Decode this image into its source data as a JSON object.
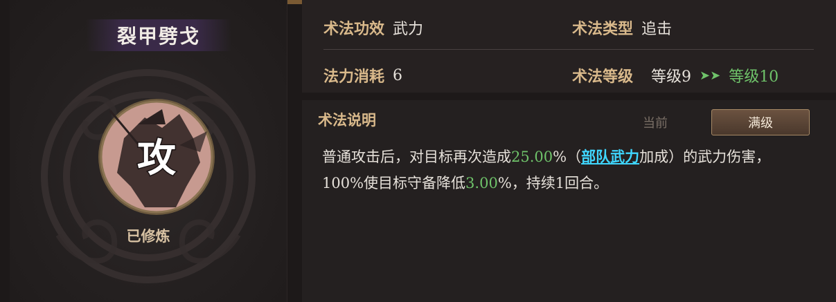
{
  "skill": {
    "name": "裂甲劈戈",
    "badge_char": "攻",
    "status": "已修炼"
  },
  "info": {
    "effect_label": "术法功效",
    "effect_value": "武力",
    "type_label": "术法类型",
    "type_value": "追击",
    "cost_label": "法力消耗",
    "cost_value": "6",
    "level_label": "术法等级",
    "level_current": "等级9",
    "level_arrow": "➤➤",
    "level_next": "等级10"
  },
  "description": {
    "title": "术法说明",
    "tab_current": "当前",
    "tab_max": "满级",
    "seg1": "普通攻击后，对目标再次造成",
    "pct1": "25.00",
    "seg2": "%（",
    "link": "部队武力",
    "seg3": "加成）的武力伤害，",
    "seg4": "100%使目标守备降低",
    "pct2": "3.00",
    "seg5": "%，持续1回合。"
  },
  "colors": {
    "label": "#d9b98b",
    "value": "#e6e1da",
    "highlight": "#6fc36a",
    "link": "#3fd7ff"
  }
}
